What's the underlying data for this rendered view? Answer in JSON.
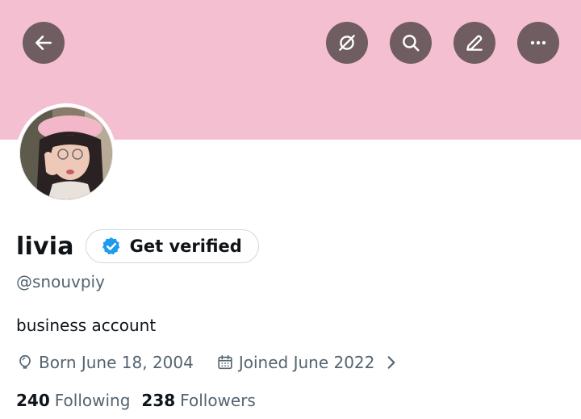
{
  "profile": {
    "display_name": "livia",
    "get_verified_label": "Get verified",
    "handle": "@snouvpiy",
    "bio": "business account",
    "born": "Born June 18, 2004",
    "joined": "Joined June 2022",
    "following_count": "240",
    "following_label": "Following",
    "followers_count": "238",
    "followers_label": "Followers"
  },
  "header": {
    "buttons": [
      "back-arrow-icon",
      "circle-slash-icon",
      "search-icon",
      "edit-pencil-icon",
      "more-dots-icon"
    ]
  },
  "colors": {
    "banner": "#f5bfd2",
    "header_button": "#6f5d62",
    "verified_blue": "#1d9bf0",
    "secondary_text": "#536471",
    "primary_text": "#0f1419"
  }
}
